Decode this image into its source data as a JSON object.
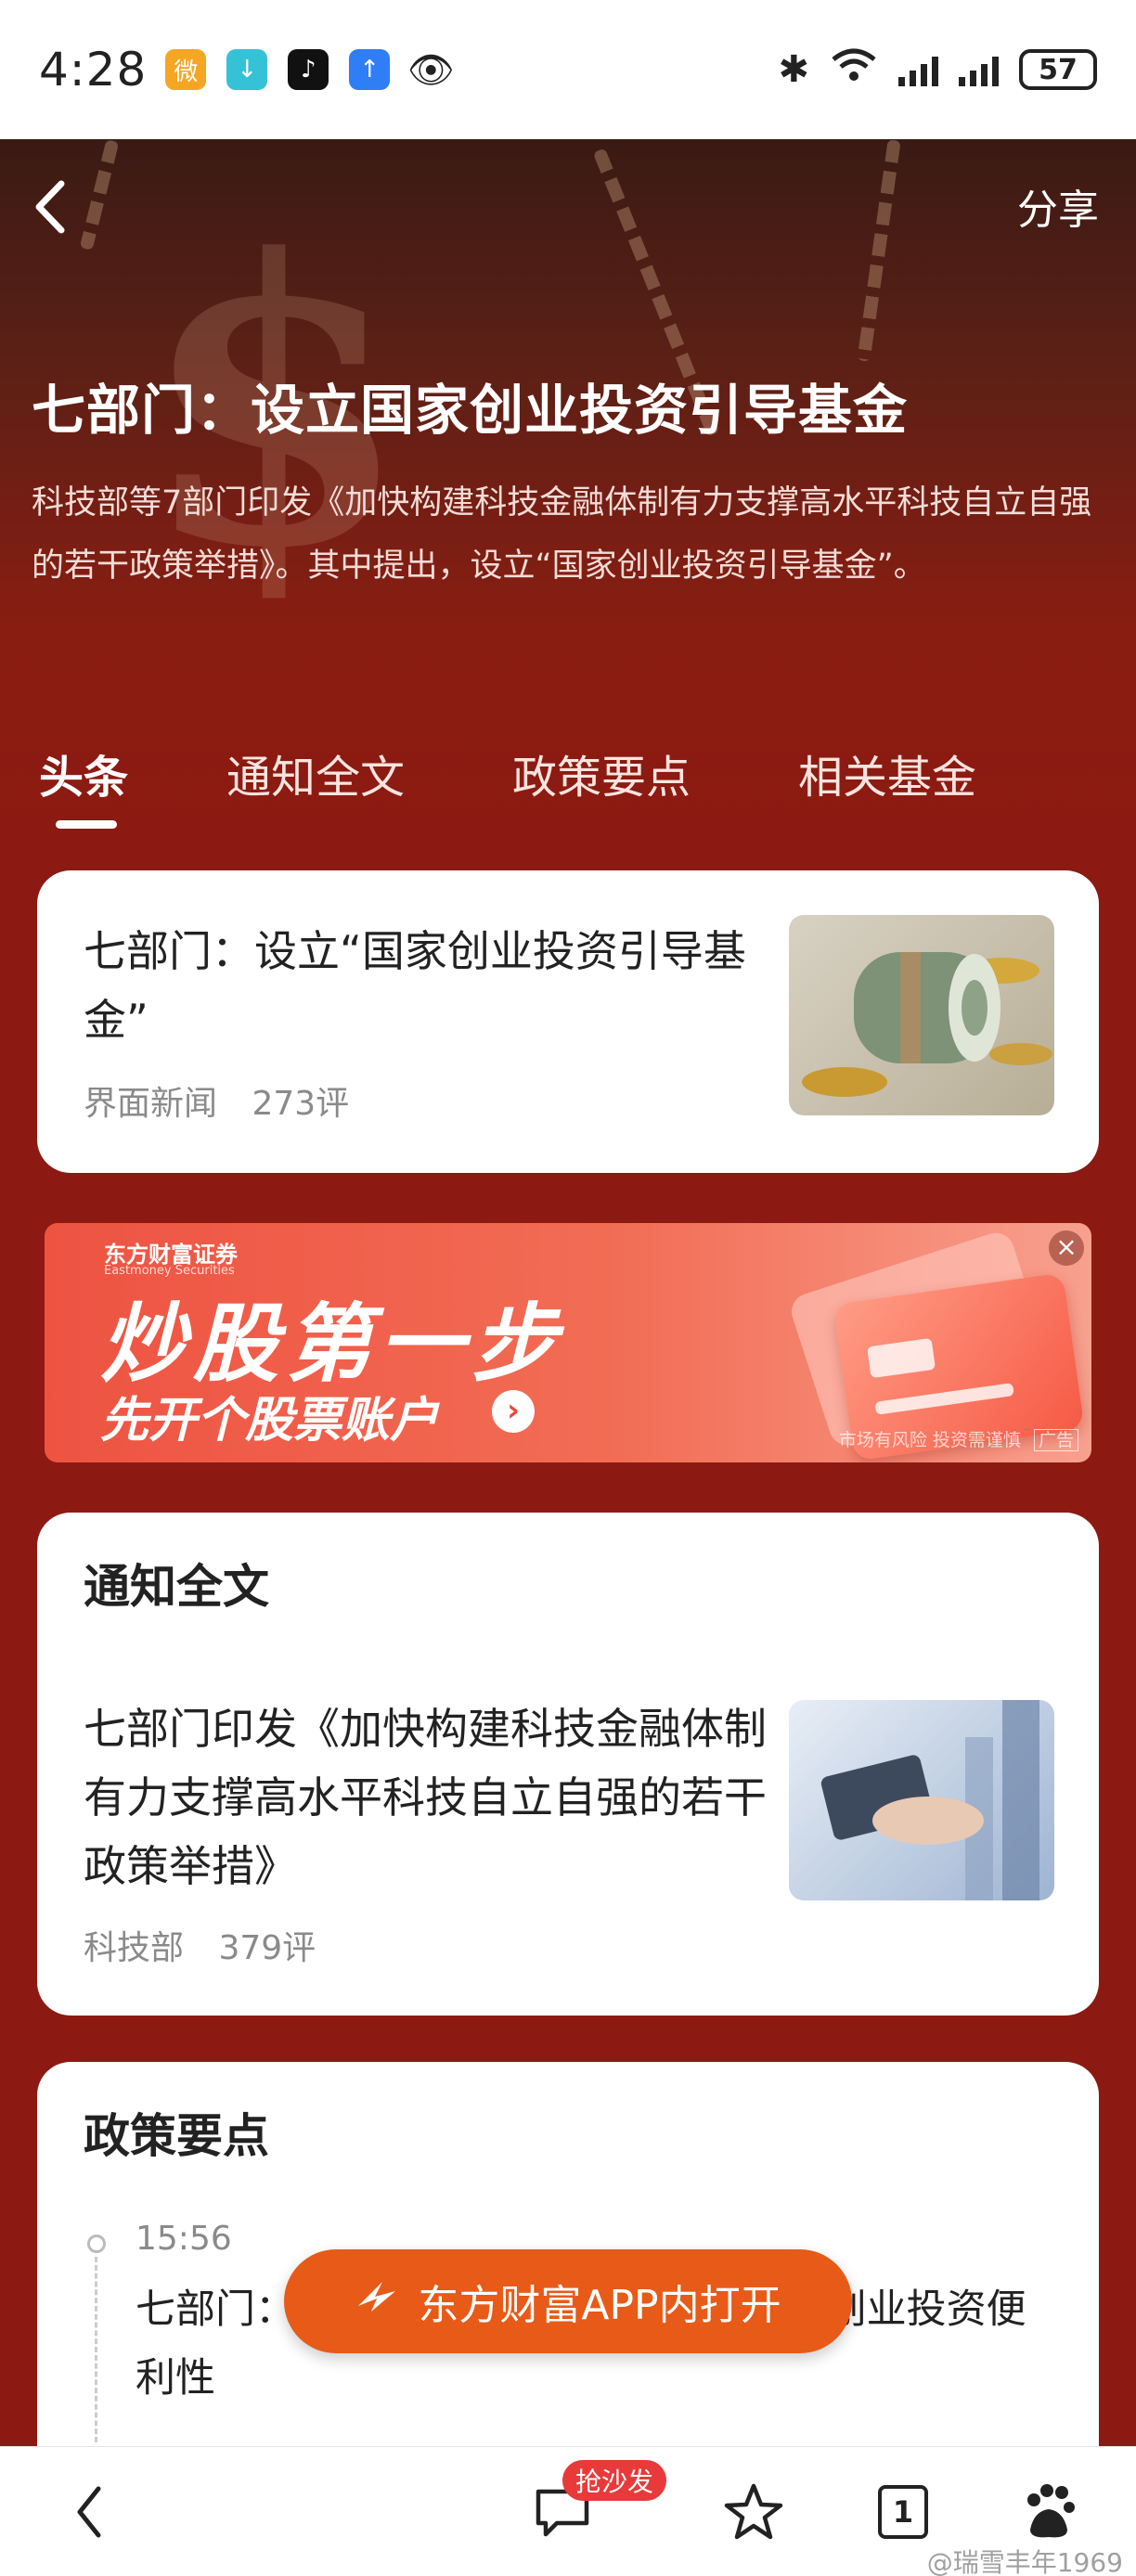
{
  "status_bar": {
    "time": "4:28",
    "battery": "57",
    "app_icons": [
      "weibo-icon",
      "download-icon",
      "tiktok-icon",
      "upload-icon",
      "eye-icon"
    ]
  },
  "header": {
    "share_label": "分享",
    "title": "七部门：设立国家创业投资引导基金",
    "description": "科技部等7部门印发《加快构建科技金融体制有力支撑高水平科技自立自强的若干政策举措》。其中提出，设立“国家创业投资引导基金”。"
  },
  "tabs": [
    {
      "label": "头条"
    },
    {
      "label": "通知全文"
    },
    {
      "label": "政策要点"
    },
    {
      "label": "相关基金"
    }
  ],
  "headline_card": {
    "title": "七部门：设立“国家创业投资引导基金”",
    "source": "界面新闻",
    "comments": "273评"
  },
  "ad": {
    "brand": "东方财富证券",
    "brand_en": "Eastmoney Securities",
    "headline": "炒股第一步",
    "subline": "先开个股票账户",
    "disclaimer": "市场有风险 投资需谨慎",
    "tag": "广告"
  },
  "notice_section": {
    "heading": "通知全文",
    "title": "七部门印发《加快构建科技金融体制 有力支撑高水平科技自立自强的若干政策举措》",
    "source": "科技部",
    "comments": "379评"
  },
  "policy_section": {
    "heading": "政策要点",
    "time": "15:56",
    "text": "七部门：     提高外资在华开展股权投资、创业投资便利性"
  },
  "open_app_button": "东方财富APP内打开",
  "bottom_nav": {
    "comment_badge": "抢沙发",
    "tab_count": "1"
  },
  "watermark": "@瑞雪丰年1969"
}
